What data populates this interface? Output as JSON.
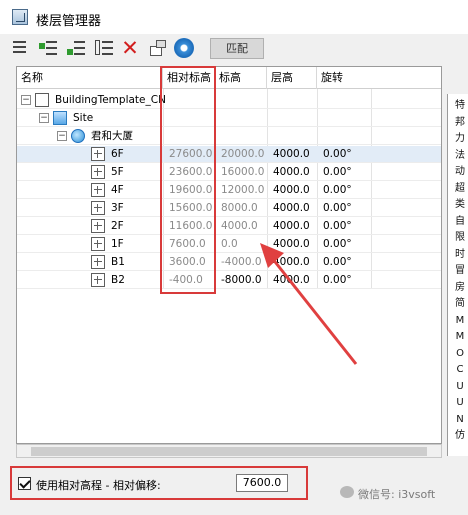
{
  "window": {
    "title": "楼层管理器"
  },
  "toolbar": {
    "match_label": "匹配"
  },
  "columns": {
    "name": "名称",
    "relative_elevation": "相对标高",
    "elevation": "标高",
    "floor_height": "层高",
    "rotation": "旋转"
  },
  "tree": {
    "root": "BuildingTemplate_CN",
    "site": "Site",
    "building": "君和大厦",
    "floors": [
      {
        "name": "6F",
        "rel": "27600.0",
        "elev": "20000.0",
        "height": "4000.0",
        "rot": "0.00°"
      },
      {
        "name": "5F",
        "rel": "23600.0",
        "elev": "16000.0",
        "height": "4000.0",
        "rot": "0.00°"
      },
      {
        "name": "4F",
        "rel": "19600.0",
        "elev": "12000.0",
        "height": "4000.0",
        "rot": "0.00°"
      },
      {
        "name": "3F",
        "rel": "15600.0",
        "elev": "8000.0",
        "height": "4000.0",
        "rot": "0.00°"
      },
      {
        "name": "2F",
        "rel": "11600.0",
        "elev": "4000.0",
        "height": "4000.0",
        "rot": "0.00°"
      },
      {
        "name": "1F",
        "rel": "7600.0",
        "elev": "0.0",
        "height": "4000.0",
        "rot": "0.00°"
      },
      {
        "name": "B1",
        "rel": "3600.0",
        "elev": "-4000.0",
        "height": "4000.0",
        "rot": "0.00°"
      },
      {
        "name": "B2",
        "rel": "-400.0",
        "elev": "-8000.0",
        "height": "4000.0",
        "rot": "0.00°"
      }
    ]
  },
  "right_panel": {
    "chars": [
      "特",
      "邦",
      "力",
      "法",
      "动",
      "超",
      "类",
      "自",
      "限",
      "时",
      "冒",
      "房",
      "简",
      "M",
      "M",
      "O",
      "C",
      "U",
      "U",
      "N",
      "仿"
    ]
  },
  "option": {
    "label": "使用相对高程 - 相对偏移:",
    "checked": true,
    "offset_value": "7600.0"
  },
  "watermark": {
    "text": "微信号: i3vsoft"
  },
  "colors": {
    "highlight": "#d83a3a",
    "arrow": "#e04040"
  }
}
